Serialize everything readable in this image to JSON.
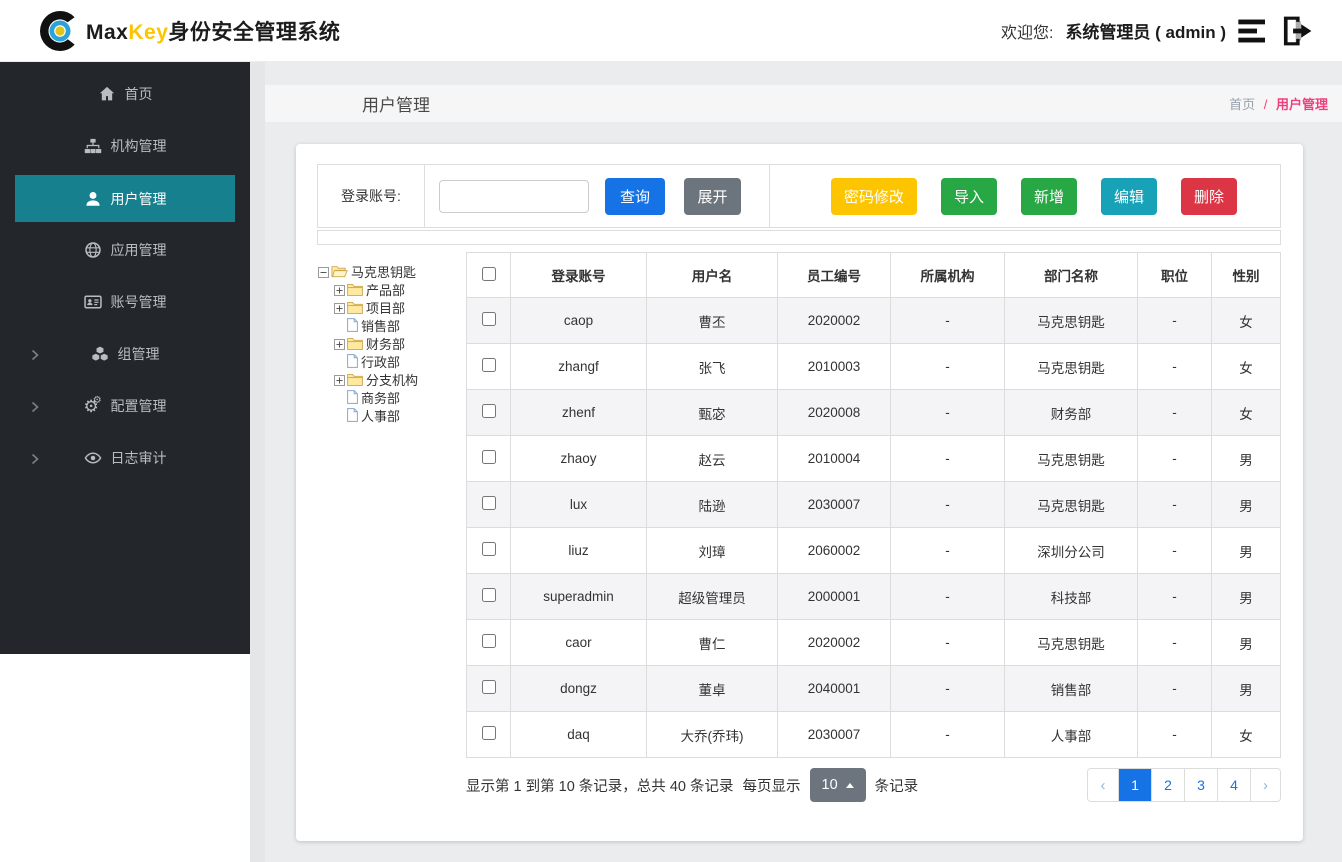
{
  "colors": {
    "accent_blue": "#1673e6",
    "success_green": "#28a745",
    "info_teal": "#17a2b8",
    "danger_red": "#dc3545",
    "warning_yellow": "#fdc500",
    "sidebar_bg": "#23272b",
    "sidebar_active_teal": "#17808f",
    "breadcrumb_pink": "#ef3f7e",
    "brand_gold": "#fdc500"
  },
  "topbar": {
    "brand": {
      "max": "Max",
      "key": "Key",
      "suffix": "身份安全管理系统"
    },
    "welcome_label": "欢迎您:",
    "username": "系统管理员 ( admin )",
    "menu_icon": "hamburger-icon",
    "logout_icon": "logout-icon"
  },
  "sidebar": {
    "items": [
      {
        "label": "首页",
        "icon": "home-icon",
        "active": false,
        "has_arrow": false
      },
      {
        "label": "机构管理",
        "icon": "sitemap-icon",
        "active": false,
        "has_arrow": false
      },
      {
        "label": "用户管理",
        "icon": "user-icon",
        "active": true,
        "has_arrow": false
      },
      {
        "label": "应用管理",
        "icon": "globe-icon",
        "active": false,
        "has_arrow": false
      },
      {
        "label": "账号管理",
        "icon": "idcard-icon",
        "active": false,
        "has_arrow": false
      },
      {
        "label": "组管理",
        "icon": "cubes-icon",
        "active": false,
        "has_arrow": true
      },
      {
        "label": "配置管理",
        "icon": "gears-icon",
        "active": false,
        "has_arrow": true
      },
      {
        "label": "日志审计",
        "icon": "eye-icon",
        "active": false,
        "has_arrow": true
      }
    ]
  },
  "page": {
    "title": "用户管理",
    "breadcrumb": {
      "home": "首页",
      "separator": "/",
      "current": "用户管理"
    }
  },
  "search": {
    "label": "登录账号:",
    "input_value": "",
    "query_label": "查询",
    "expand_label": "展开",
    "actions": [
      {
        "name": "password-modify-button",
        "label": "密码修改",
        "color": "#fdc500"
      },
      {
        "name": "import-button",
        "label": "导入",
        "color": "#28a745"
      },
      {
        "name": "add-button",
        "label": "新增",
        "color": "#28a745"
      },
      {
        "name": "edit-button",
        "label": "编辑",
        "color": "#17a2b8"
      },
      {
        "name": "delete-button",
        "label": "删除",
        "color": "#dc3545"
      }
    ]
  },
  "tree": {
    "root": {
      "label": "马克思钥匙",
      "expanded": true,
      "icon": "folder-open-icon"
    },
    "children": [
      {
        "label": "产品部",
        "type": "folder",
        "expandable": true
      },
      {
        "label": "项目部",
        "type": "folder",
        "expandable": true
      },
      {
        "label": "销售部",
        "type": "leaf",
        "expandable": false
      },
      {
        "label": "财务部",
        "type": "folder",
        "expandable": true
      },
      {
        "label": "行政部",
        "type": "leaf",
        "expandable": false
      },
      {
        "label": "分支机构",
        "type": "folder",
        "expandable": true
      },
      {
        "label": "商务部",
        "type": "leaf",
        "expandable": false
      },
      {
        "label": "人事部",
        "type": "leaf",
        "expandable": false
      }
    ]
  },
  "table": {
    "headers": [
      {
        "key": "login_account",
        "label": "登录账号"
      },
      {
        "key": "username",
        "label": "用户名"
      },
      {
        "key": "employee_no",
        "label": "员工编号"
      },
      {
        "key": "organization",
        "label": "所属机构"
      },
      {
        "key": "department",
        "label": "部门名称"
      },
      {
        "key": "position",
        "label": "职位"
      },
      {
        "key": "gender",
        "label": "性别"
      }
    ],
    "rows": [
      [
        "caop",
        "曹丕",
        "2020002",
        "-",
        "马克思钥匙",
        "-",
        "女"
      ],
      [
        "zhangf",
        "张飞",
        "2010003",
        "-",
        "马克思钥匙",
        "-",
        "女"
      ],
      [
        "zhenf",
        "甄宓",
        "2020008",
        "-",
        "财务部",
        "-",
        "女"
      ],
      [
        "zhaoy",
        "赵云",
        "2010004",
        "-",
        "马克思钥匙",
        "-",
        "男"
      ],
      [
        "lux",
        "陆逊",
        "2030007",
        "-",
        "马克思钥匙",
        "-",
        "男"
      ],
      [
        "liuz",
        "刘璋",
        "2060002",
        "-",
        "深圳分公司",
        "-",
        "男"
      ],
      [
        "superadmin",
        "超级管理员",
        "2000001",
        "-",
        "科技部",
        "-",
        "男"
      ],
      [
        "caor",
        "曹仁",
        "2020002",
        "-",
        "马克思钥匙",
        "-",
        "男"
      ],
      [
        "dongz",
        "董卓",
        "2040001",
        "-",
        "销售部",
        "-",
        "男"
      ],
      [
        "daq",
        "大乔(乔玮)",
        "2030007",
        "-",
        "人事部",
        "-",
        "女"
      ]
    ]
  },
  "footer": {
    "summary": "显示第 1 到第 10 条记录，总共 40 条记录",
    "per_page_label": "每页显示",
    "per_page_value": "10",
    "per_page_suffix": "条记录",
    "pagination": {
      "prev_label": "‹",
      "pages": [
        "1",
        "2",
        "3",
        "4"
      ],
      "active_page": "1",
      "next_label": "›"
    }
  }
}
